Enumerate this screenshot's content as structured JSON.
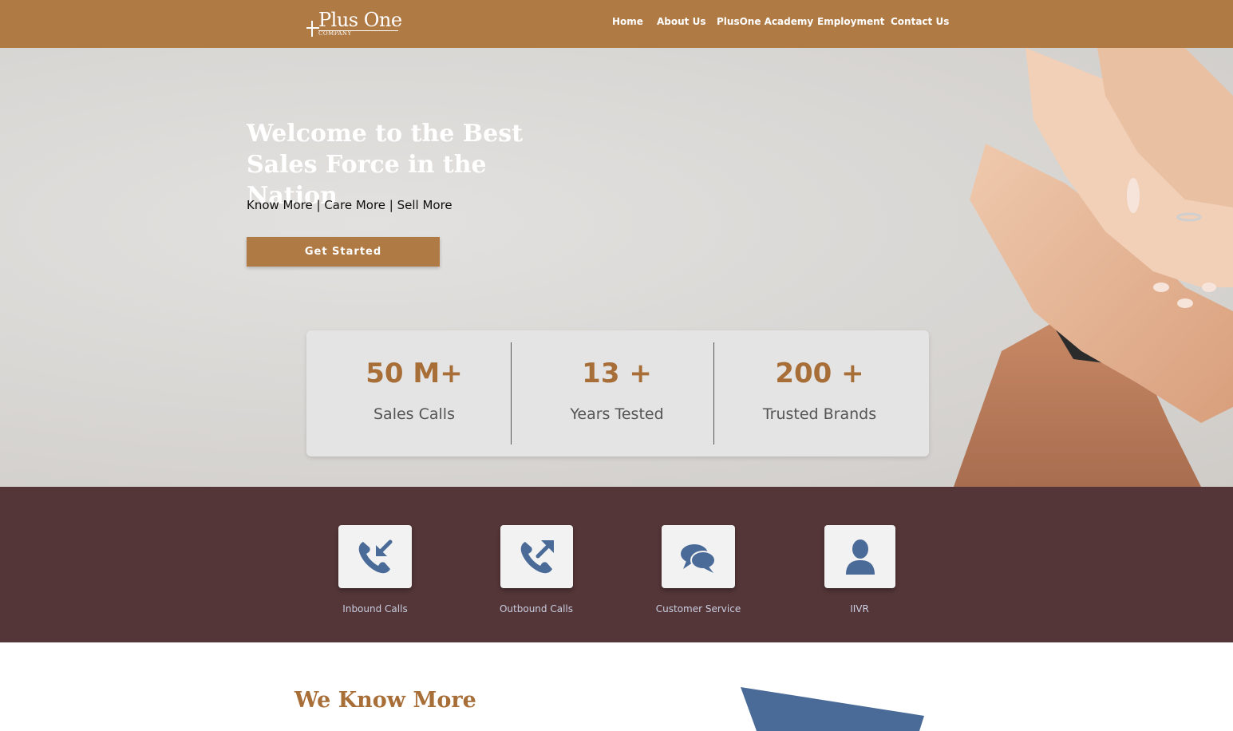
{
  "header": {
    "logo": {
      "main": "Plus One",
      "sub": "COMPANY"
    },
    "nav": [
      {
        "label": "Home"
      },
      {
        "label": "About Us"
      },
      {
        "label": "PlusOne Academy"
      },
      {
        "label": "Employment"
      },
      {
        "label": "Contact Us"
      }
    ]
  },
  "hero": {
    "title": "Welcome to the Best Sales Force in the Nation",
    "tagline": "Know More | Care More | Sell More",
    "cta_label": "Get Started"
  },
  "stats": [
    {
      "value": "50 M+",
      "label": "Sales Calls"
    },
    {
      "value": "13 +",
      "label": "Years Tested"
    },
    {
      "value": "200 +",
      "label": "Trusted Brands"
    }
  ],
  "services": [
    {
      "label": "Inbound Calls",
      "icon": "phone-inbound-icon"
    },
    {
      "label": "Outbound Calls",
      "icon": "phone-outbound-icon"
    },
    {
      "label": "Customer Service",
      "icon": "chat-bubbles-icon"
    },
    {
      "label": "IIVR",
      "icon": "user-icon"
    }
  ],
  "section": {
    "heading": "We Know More"
  },
  "colors": {
    "brand": "#b07a45",
    "accent_text": "#a86e38",
    "services_bg": "#543638",
    "icon_blue": "#4a6b98"
  }
}
